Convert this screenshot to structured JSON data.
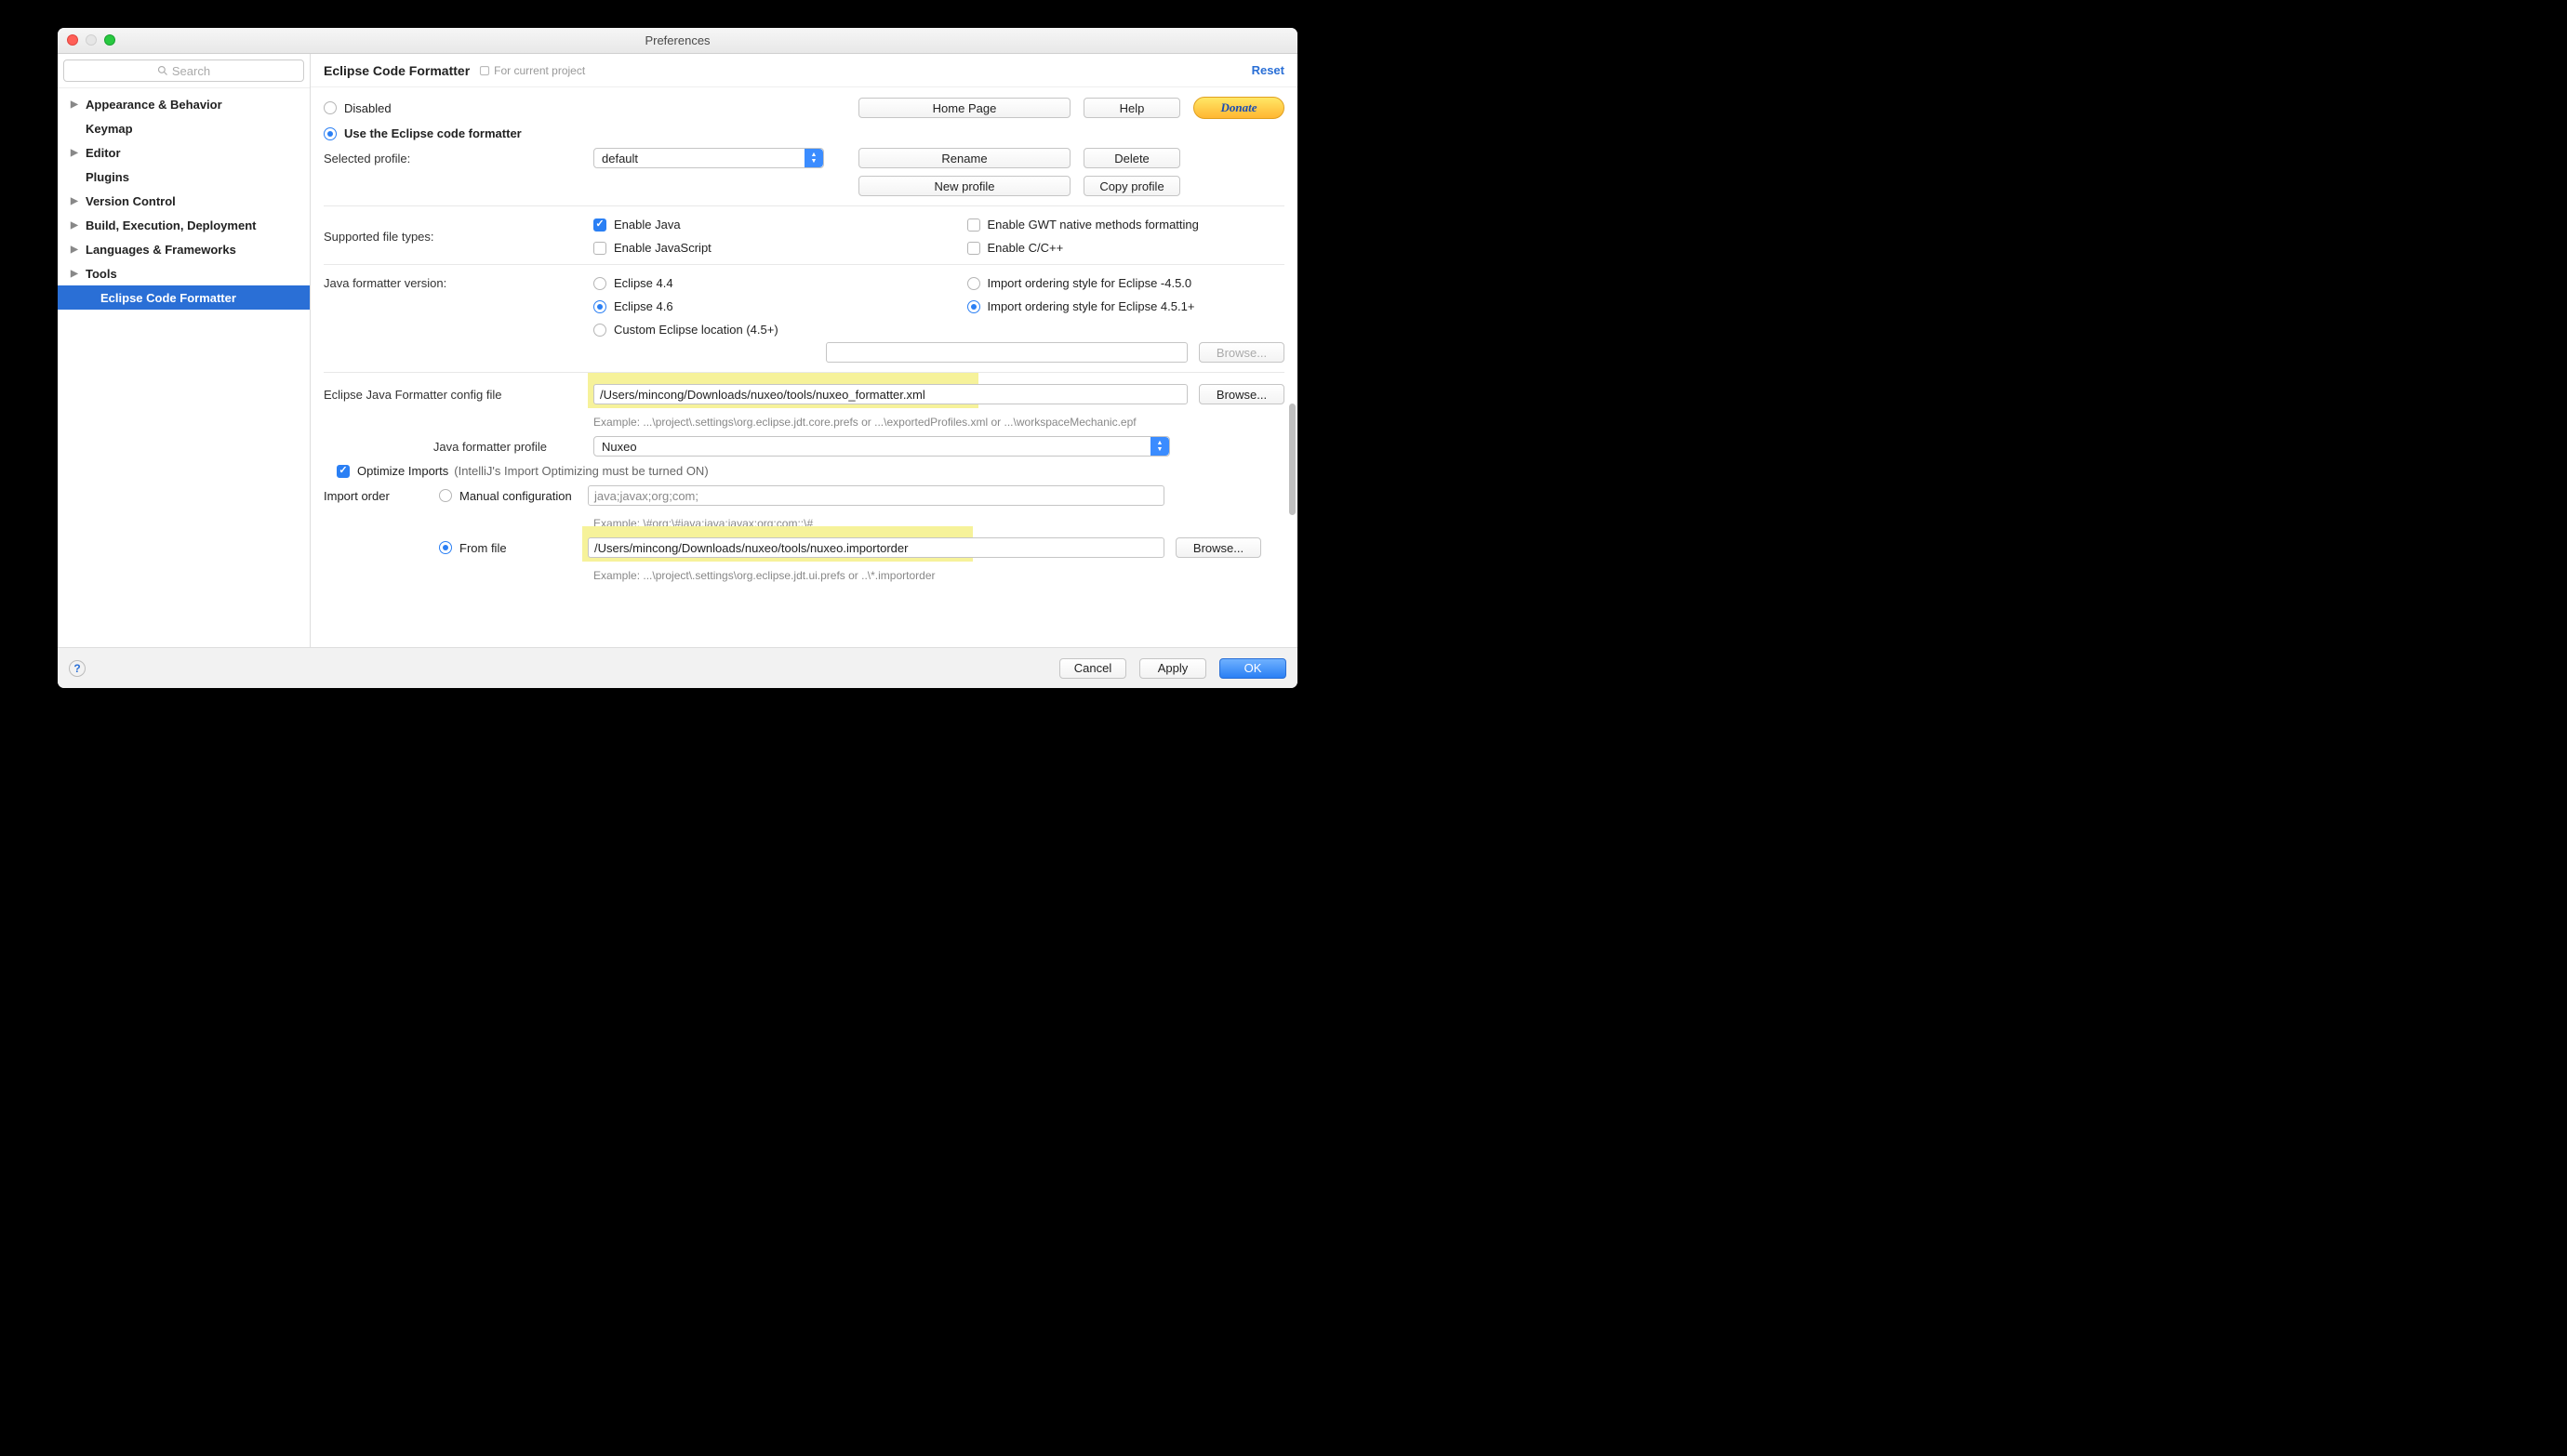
{
  "window": {
    "title": "Preferences"
  },
  "search": {
    "placeholder": "Search"
  },
  "sidebar": {
    "items": [
      {
        "label": "Appearance & Behavior",
        "bold": true,
        "arrow": true
      },
      {
        "label": "Keymap",
        "bold": true,
        "arrow": false
      },
      {
        "label": "Editor",
        "bold": true,
        "arrow": true
      },
      {
        "label": "Plugins",
        "bold": true,
        "arrow": false
      },
      {
        "label": "Version Control",
        "bold": true,
        "arrow": true
      },
      {
        "label": "Build, Execution, Deployment",
        "bold": true,
        "arrow": true
      },
      {
        "label": "Languages & Frameworks",
        "bold": true,
        "arrow": true
      },
      {
        "label": "Tools",
        "bold": true,
        "arrow": true
      },
      {
        "label": "Eclipse Code Formatter",
        "bold": true,
        "arrow": false,
        "selected": true,
        "child": true
      }
    ]
  },
  "header": {
    "title": "Eclipse Code Formatter",
    "scope": "For current project",
    "reset": "Reset"
  },
  "buttons": {
    "homepage": "Home Page",
    "help": "Help",
    "donate": "Donate",
    "rename": "Rename",
    "delete": "Delete",
    "newprofile": "New profile",
    "copyprofile": "Copy profile",
    "browse": "Browse...",
    "cancel": "Cancel",
    "apply": "Apply",
    "ok": "OK"
  },
  "mode": {
    "disabled": "Disabled",
    "use": "Use the Eclipse code formatter"
  },
  "profile": {
    "label": "Selected profile:",
    "value": "default"
  },
  "supported": {
    "label": "Supported file types:",
    "enable_java": "Enable Java",
    "enable_js": "Enable JavaScript",
    "enable_gwt": "Enable GWT native methods formatting",
    "enable_cpp": "Enable C/C++"
  },
  "version": {
    "label": "Java formatter version:",
    "eclipse44": "Eclipse 4.4",
    "eclipse46": "Eclipse 4.6",
    "custom": "Custom Eclipse location (4.5+)",
    "import450": "Import ordering style for Eclipse -4.5.0",
    "import451": "Import ordering style for Eclipse 4.5.1+"
  },
  "config": {
    "label": "Eclipse Java Formatter config file",
    "value": "/Users/mincong/Downloads/nuxeo/tools/nuxeo_formatter.xml",
    "example": "Example: ...\\project\\.settings\\org.eclipse.jdt.core.prefs or ...\\exportedProfiles.xml or ...\\workspaceMechanic.epf"
  },
  "jprofile": {
    "label": "Java formatter profile",
    "value": "Nuxeo"
  },
  "optimize": {
    "label": "Optimize Imports",
    "hint": "(IntelliJ's Import Optimizing must be turned ON)"
  },
  "order": {
    "label": "Import order",
    "manual": "Manual configuration",
    "manual_value": "java;javax;org;com;",
    "manual_example": "Example: \\#org;\\#java;java;javax;org;com;;\\#",
    "fromfile": "From file",
    "fromfile_value": "/Users/mincong/Downloads/nuxeo/tools/nuxeo.importorder",
    "fromfile_example": "Example: ...\\project\\.settings\\org.eclipse.jdt.ui.prefs or ..\\*.importorder"
  }
}
